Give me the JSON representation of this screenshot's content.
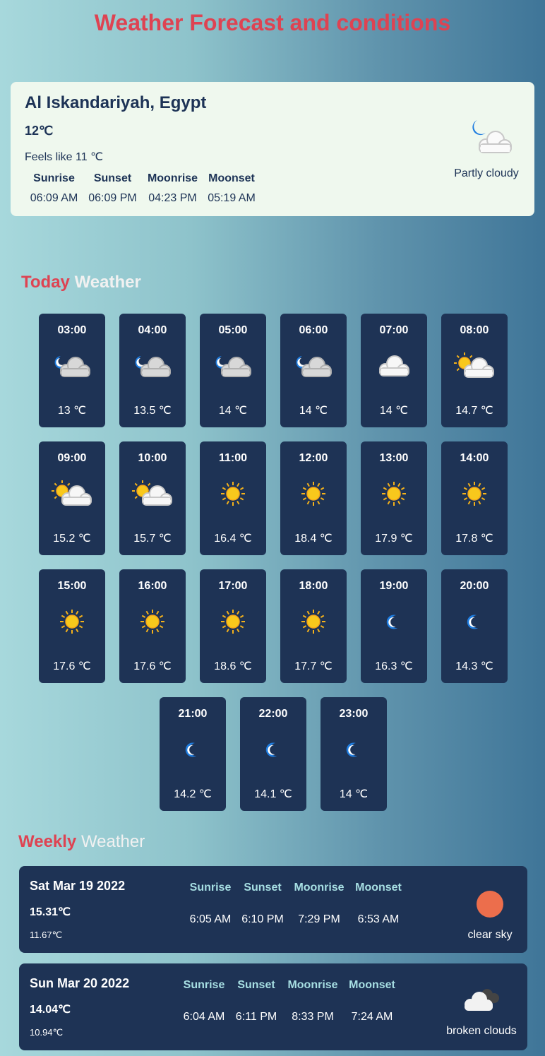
{
  "header": {
    "title": "Weather Forecast and conditions"
  },
  "current": {
    "location": "Al Iskandariyah, Egypt",
    "temp": "12℃",
    "feels_like": "Feels like 11 ℃",
    "labels": [
      "Sunrise",
      "Sunset",
      "Moonrise",
      "Moonset"
    ],
    "values": [
      "06:09 AM",
      "06:09 PM",
      "04:23 PM",
      "05:19 AM"
    ],
    "condition": "Partly cloudy",
    "icon": "moon-cloud-icon"
  },
  "today": {
    "title_highlight": "Today",
    "title_rest": "Weather",
    "hours": [
      {
        "time": "03:00",
        "temp": "13 ℃",
        "icon": "moon-cloud"
      },
      {
        "time": "04:00",
        "temp": "13.5 ℃",
        "icon": "moon-cloud"
      },
      {
        "time": "05:00",
        "temp": "14 ℃",
        "icon": "moon-cloud"
      },
      {
        "time": "06:00",
        "temp": "14 ℃",
        "icon": "moon-cloud"
      },
      {
        "time": "07:00",
        "temp": "14 ℃",
        "icon": "cloud"
      },
      {
        "time": "08:00",
        "temp": "14.7 ℃",
        "icon": "sun-cloud"
      },
      {
        "time": "09:00",
        "temp": "15.2 ℃",
        "icon": "sun-cloud"
      },
      {
        "time": "10:00",
        "temp": "15.7 ℃",
        "icon": "sun-cloud"
      },
      {
        "time": "11:00",
        "temp": "16.4 ℃",
        "icon": "sun"
      },
      {
        "time": "12:00",
        "temp": "18.4 ℃",
        "icon": "sun"
      },
      {
        "time": "13:00",
        "temp": "17.9 ℃",
        "icon": "sun"
      },
      {
        "time": "14:00",
        "temp": "17.8 ℃",
        "icon": "sun"
      },
      {
        "time": "15:00",
        "temp": "17.6 ℃",
        "icon": "sun"
      },
      {
        "time": "16:00",
        "temp": "17.6 ℃",
        "icon": "sun"
      },
      {
        "time": "17:00",
        "temp": "18.6 ℃",
        "icon": "sun"
      },
      {
        "time": "18:00",
        "temp": "17.7 ℃",
        "icon": "sun"
      },
      {
        "time": "19:00",
        "temp": "16.3 ℃",
        "icon": "moon"
      },
      {
        "time": "20:00",
        "temp": "14.3 ℃",
        "icon": "moon"
      },
      {
        "time": "21:00",
        "temp": "14.2 ℃",
        "icon": "moon"
      },
      {
        "time": "22:00",
        "temp": "14.1 ℃",
        "icon": "moon"
      },
      {
        "time": "23:00",
        "temp": "14 ℃",
        "icon": "moon"
      }
    ]
  },
  "weekly": {
    "title_highlight": "Weekly",
    "title_rest": "Weather",
    "labels": [
      "Sunrise",
      "Sunset",
      "Moonrise",
      "Moonset"
    ],
    "days": [
      {
        "date": "Sat Mar 19 2022",
        "max": "15.31℃",
        "min": "11.67℃",
        "values": [
          "6:05 AM",
          "6:10 PM",
          "7:29 PM",
          "6:53 AM"
        ],
        "condition": "clear sky",
        "icon": "sun-disc",
        "sun_color": "#ec6e4c"
      },
      {
        "date": "Sun Mar 20 2022",
        "max": "14.04℃",
        "min": "10.94℃",
        "values": [
          "6:04 AM",
          "6:11 PM",
          "8:33 PM",
          "7:24 AM"
        ],
        "condition": "broken clouds",
        "icon": "broken-clouds"
      }
    ]
  },
  "colors": {
    "accent": "#de4352",
    "card": "#1e3355",
    "current_bg": "#eff8ee",
    "label_teal": "#a7dfe3"
  }
}
